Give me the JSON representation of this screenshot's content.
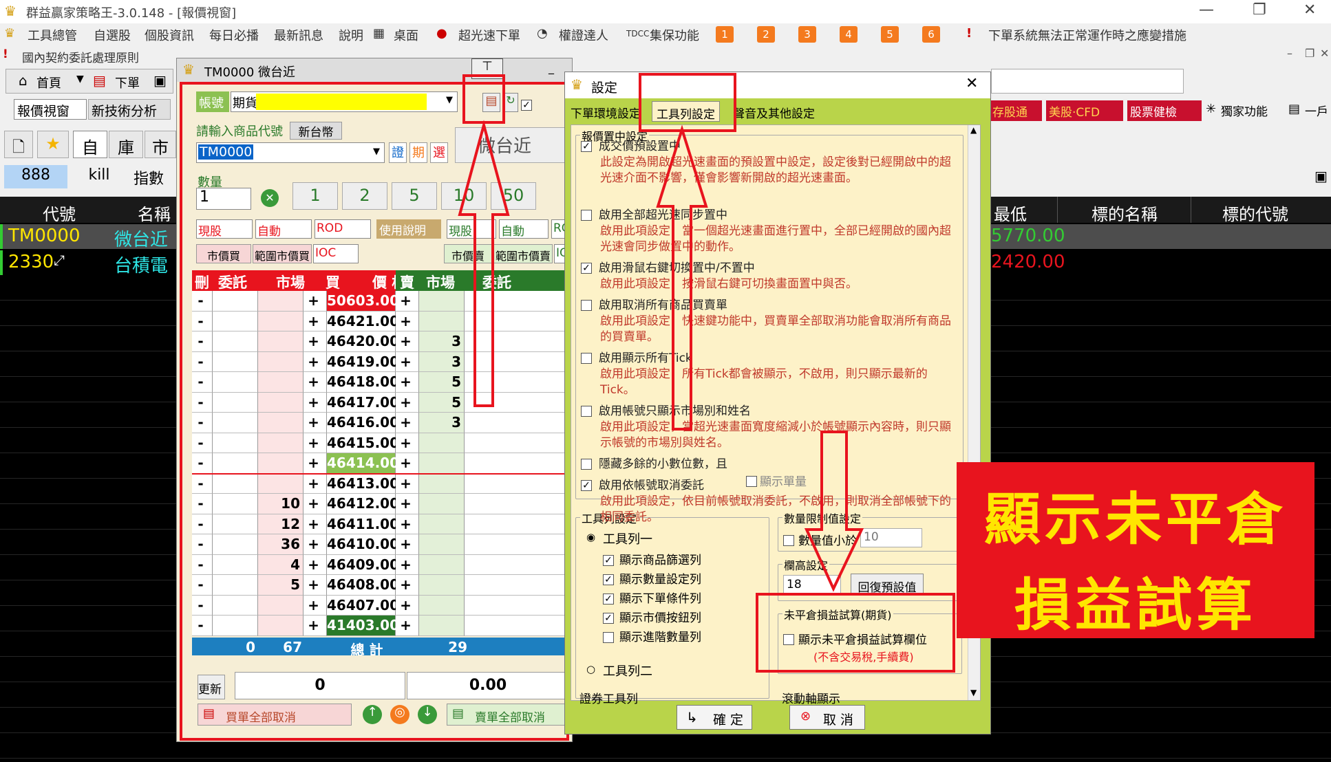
{
  "app": {
    "title": "群益贏家策略王-3.0.148 - [報價視窗]"
  },
  "menubar": {
    "items": [
      "工具總管",
      "自選股",
      "個股資訊",
      "每日必播",
      "最新訊息",
      "說明",
      "桌面",
      "超光速下單",
      "權證達人",
      "集保功能"
    ],
    "numbers": [
      "1",
      "2",
      "3",
      "4",
      "5",
      "6"
    ],
    "notice": "下單系統無法正常運作時之應變措施"
  },
  "row3": {
    "left": "國內契約委託處理原則"
  },
  "toolbar": {
    "home": "首頁",
    "order": "下單",
    "quote_view": "報價視窗",
    "new_tech": "新技術分析",
    "tabs": [
      "自",
      "庫",
      "市"
    ],
    "b888": "888",
    "kill": "kill",
    "index": "指數",
    "right_btns": [
      "存股通",
      "美股‧CFD",
      "股票健檢",
      "獨家功能",
      "一戶"
    ]
  },
  "grid": {
    "headers": [
      "代號",
      "名稱",
      "最低",
      "標的名稱",
      "標的代號"
    ],
    "rows": [
      {
        "code": "TM0000",
        "name": "微台近",
        "low": "5770.00"
      },
      {
        "code": "2330",
        "name": "台積電",
        "low": "2420.00"
      }
    ]
  },
  "order_window": {
    "title": "TM0000 微台近",
    "account_label": "帳號",
    "account_value": "期貨",
    "product_prompt": "請輸入商品代號",
    "currency": "新台幣",
    "product_code": "TM0000",
    "quick_btns": [
      "證",
      "期",
      "選"
    ],
    "product_name": "微台近",
    "qty_label": "數量",
    "qty_value": "1",
    "qty_presets": [
      "1",
      "2",
      "5",
      "10",
      "50"
    ],
    "left_selects": [
      "現股",
      "自動",
      "ROD"
    ],
    "help": "使用說明",
    "right_selects": [
      "現股",
      "自動",
      "RO"
    ],
    "market_btns": [
      "市價買",
      "範圍市價買",
      "IOC"
    ],
    "market_btns_r": [
      "市價賣",
      "範圍市價賣",
      "IO"
    ],
    "ladder_headers": [
      "刪",
      "委託",
      "市場",
      "買",
      "價 格",
      "賣",
      "市場",
      "委託"
    ],
    "ladder": [
      {
        "price": "50603.00",
        "bid": "",
        "ask": "",
        "hl": "high"
      },
      {
        "price": "46421.00",
        "bid": "",
        "ask": ""
      },
      {
        "price": "46420.00",
        "bid": "",
        "ask": "3"
      },
      {
        "price": "46419.00",
        "bid": "",
        "ask": "3"
      },
      {
        "price": "46418.00",
        "bid": "",
        "ask": "5"
      },
      {
        "price": "46417.00",
        "bid": "",
        "ask": "5"
      },
      {
        "price": "46416.00",
        "bid": "",
        "ask": "3"
      },
      {
        "price": "46415.00",
        "bid": "",
        "ask": ""
      },
      {
        "price": "46414.00",
        "bid": "",
        "ask": "",
        "hl": "last"
      },
      {
        "price": "46413.00",
        "bid": "",
        "ask": ""
      },
      {
        "price": "46412.00",
        "bid": "10",
        "ask": ""
      },
      {
        "price": "46411.00",
        "bid": "12",
        "ask": ""
      },
      {
        "price": "46410.00",
        "bid": "36",
        "ask": ""
      },
      {
        "price": "46409.00",
        "bid": "4",
        "ask": ""
      },
      {
        "price": "46408.00",
        "bid": "5",
        "ask": ""
      },
      {
        "price": "46407.00",
        "bid": "",
        "ask": ""
      },
      {
        "price": "41403.00",
        "bid": "",
        "ask": "",
        "hl": "low"
      }
    ],
    "total": {
      "del": "0",
      "bid": "67",
      "label": "總 計",
      "ask": "29"
    },
    "update": "更新",
    "pos": "0",
    "pnl": "0.00",
    "cancel_buy": "買單全部取消",
    "cancel_sell": "賣單全部取消"
  },
  "settings": {
    "title": "設定",
    "tabs": [
      "下單環境設定",
      "工具列設定",
      "聲音及其他設定"
    ],
    "group_quote": "報價置中設定",
    "options": [
      {
        "checked": true,
        "label": "成交價預設置中",
        "desc": "此設定為開啟超光速畫面的預設置中設定，設定後對已經開啟中的超光速介面不影響，僅會影響新開啟的超光速畫面。"
      },
      {
        "checked": false,
        "label": "啟用全部超光速同步置中",
        "desc": "啟用此項設定，當一個超光速畫面進行置中，全部已經開啟的國內超光速會同步做置中的動作。"
      },
      {
        "checked": true,
        "label": "啟用滑鼠右鍵切換置中/不置中",
        "desc": "啟用此項設定，按滑鼠右鍵可切換畫面置中與否。"
      },
      {
        "checked": false,
        "label": "啟用取消所有商品買賣單",
        "desc": "啟用此項設定，快速鍵功能中，買賣單全部取消功能會取消所有商品的買賣單。"
      },
      {
        "checked": false,
        "label": "啟用顯示所有Tick",
        "desc": "啟用此項設定，所有Tick都會被顯示，不啟用，則只顯示最新的Tick。"
      },
      {
        "checked": false,
        "label": "啟用帳號只顯示市場別和姓名",
        "desc": "啟用此項設定，當超光速畫面寬度縮減小於帳號顯示內容時，則只顯示帳號的市場別與姓名。"
      },
      {
        "checked": false,
        "label": "隱藏多餘的小數位數，且",
        "desc": ""
      },
      {
        "checked": true,
        "label": "啟用依帳號取消委託",
        "desc": "啟用此項設定，依目前帳號取消委託，不啟用，則取消全部帳號下的相同委託。"
      }
    ],
    "show_single": "顯示單量",
    "toolbar_group": "工具列設定",
    "toolbar1": "工具列一",
    "toolbar1_items": [
      {
        "checked": true,
        "label": "顯示商品篩選列"
      },
      {
        "checked": true,
        "label": "顯示數量設定列"
      },
      {
        "checked": true,
        "label": "顯示下單條件列"
      },
      {
        "checked": true,
        "label": "顯示市價按鈕列"
      },
      {
        "checked": false,
        "label": "顯示進階數量列"
      }
    ],
    "toolbar2": "工具列二",
    "qty_limit_group": "數量限制值設定",
    "qty_limit_label": "數量值小於",
    "qty_limit_value": "10",
    "row_height_group": "欄高設定",
    "row_height_value": "18",
    "reset": "回復預設值",
    "upl_group": "未平倉損益試算(期貨)",
    "upl_label": "顯示未平倉損益試算欄位",
    "upl_note": "(不含交易稅,手續費)",
    "bottom_left": "證券工具列",
    "bottom_right": "滾動軸顯示",
    "ok": "確 定",
    "cancel": "取 消"
  },
  "banner": {
    "line1": "顯示未平倉",
    "line2": "損益試算"
  },
  "colors": {
    "annotation_red": "#e8141e",
    "banner_text": "#ffe600",
    "dialog_green": "#b9d44a",
    "price_high_bg": "#e8141e",
    "price_last_bg": "#8cc152",
    "price_low_bg": "#2a7a2a"
  }
}
